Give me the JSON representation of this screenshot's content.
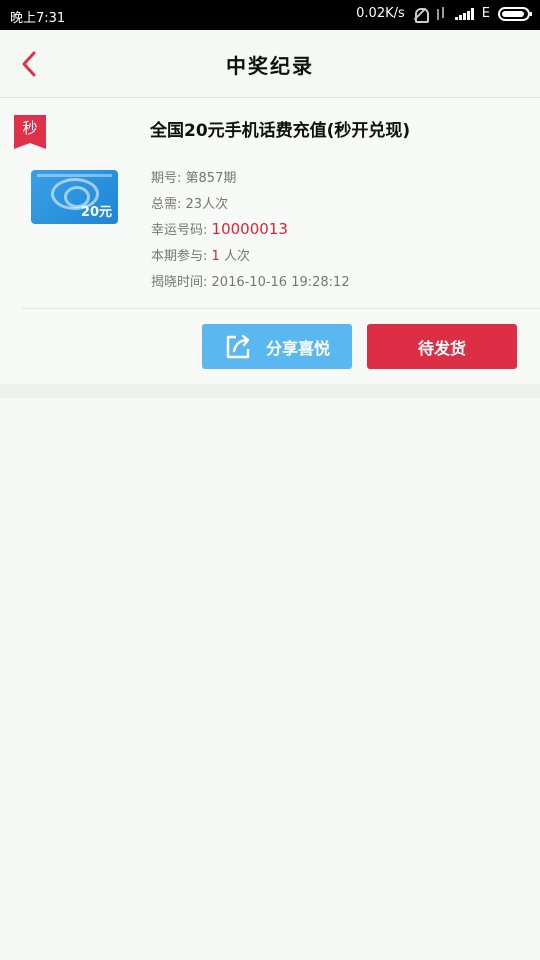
{
  "status_bar": {
    "time": "晚上7:31",
    "speed": "0.02K/s",
    "network": "E"
  },
  "header": {
    "title": "中奖纪录"
  },
  "record": {
    "badge": "秒",
    "title": "全国20元手机话费充值(秒开兑现)",
    "card_value": "20元",
    "period_label": "期号:",
    "period_value": "第857期",
    "total_label": "总需:",
    "total_value": "23人次",
    "lucky_label": "幸运号码:",
    "lucky_value": "10000013",
    "joined_label": "本期参与:",
    "joined_count": "1",
    "joined_unit": "人次",
    "reveal_label": "揭晓时间:",
    "reveal_value": "2016-10-16 19:28:12"
  },
  "actions": {
    "share_label": "分享喜悦",
    "status_label": "待发货"
  },
  "colors": {
    "accent_red": "#dc2e45",
    "share_blue": "#5ab7ef"
  }
}
